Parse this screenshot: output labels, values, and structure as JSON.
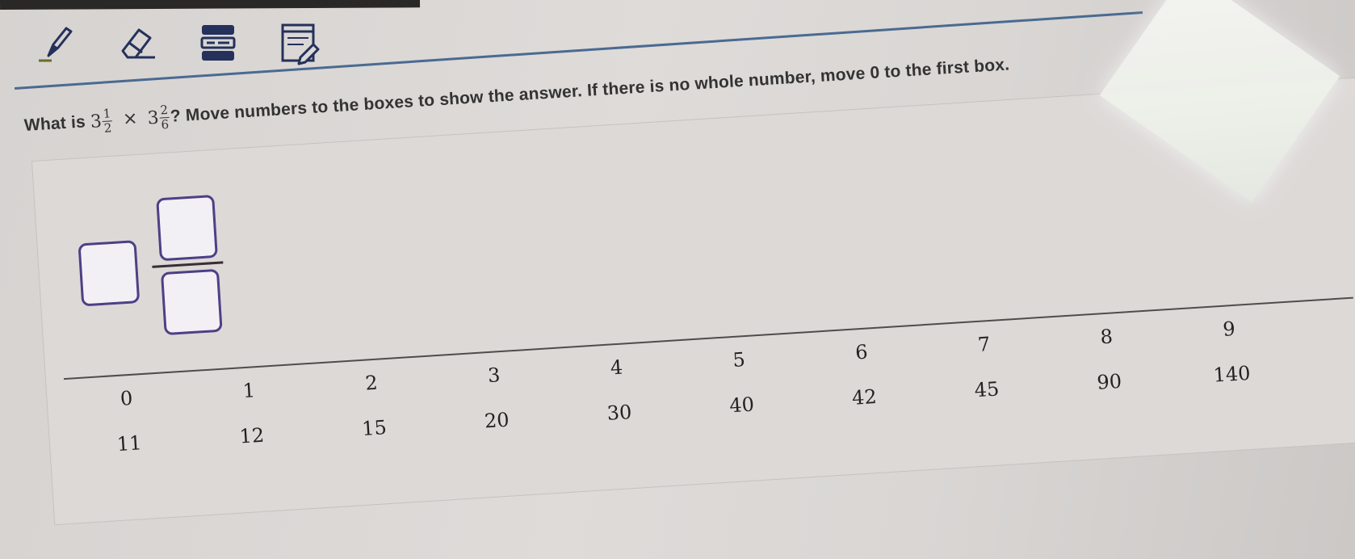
{
  "toolbar": {
    "tools": [
      {
        "name": "highlighter",
        "icon": "highlighter-icon"
      },
      {
        "name": "eraser",
        "icon": "eraser-icon"
      },
      {
        "name": "line reader",
        "icon": "line-reader-icon"
      },
      {
        "name": "notepad",
        "icon": "notepad-icon"
      }
    ],
    "accent_color": "#4a6a91",
    "icon_color": "#24315b"
  },
  "question": {
    "prefix": "What is",
    "a_whole": "3",
    "a_num": "1",
    "a_den": "2",
    "operator": "×",
    "b_whole": "3",
    "b_num": "2",
    "b_den": "6",
    "suffix": "? Move numbers to the boxes to show the answer. If there is no whole number, move 0 to the first box."
  },
  "answer_boxes": {
    "border_color": "#4e3f86"
  },
  "tiles": {
    "row1": [
      "0",
      "1",
      "2",
      "3",
      "4",
      "5",
      "6",
      "7",
      "8",
      "9"
    ],
    "row2": [
      "11",
      "12",
      "15",
      "20",
      "30",
      "40",
      "42",
      "45",
      "90",
      "140"
    ]
  }
}
